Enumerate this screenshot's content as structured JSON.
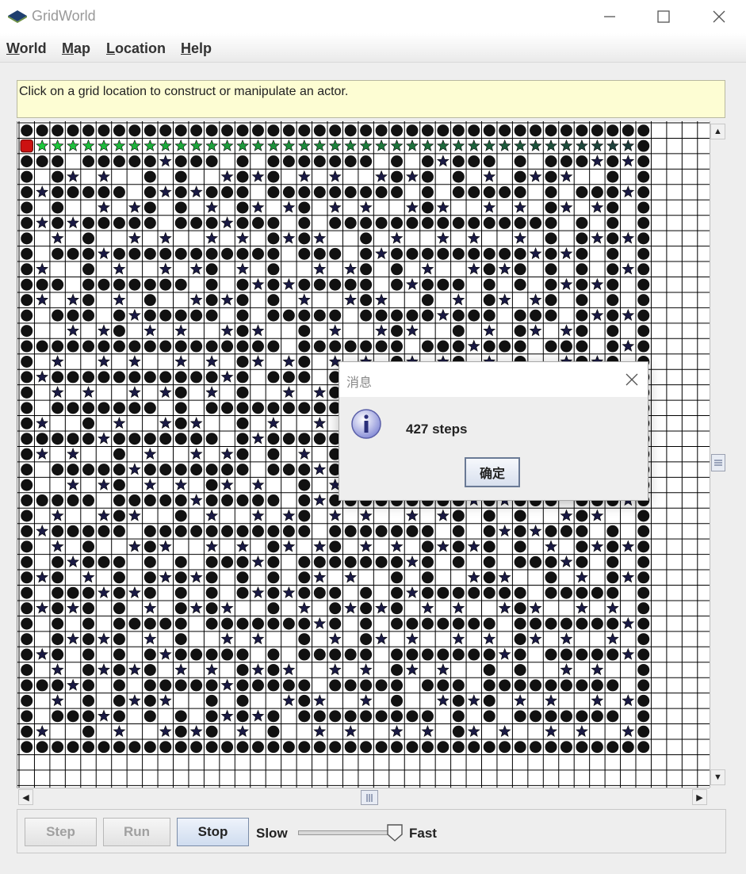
{
  "window": {
    "title": "GridWorld"
  },
  "menu": [
    {
      "label": "World",
      "mnemonic": "W",
      "rest": "orld"
    },
    {
      "label": "Map",
      "mnemonic": "M",
      "rest": "ap"
    },
    {
      "label": "Location",
      "mnemonic": "L",
      "rest": "ocation"
    },
    {
      "label": "Help",
      "mnemonic": "H",
      "rest": "elp"
    }
  ],
  "info": {
    "message": "Click on a grid location to construct or manipulate an actor."
  },
  "controls": {
    "step_label": "Step",
    "run_label": "Run",
    "stop_label": "Stop",
    "slow_label": "Slow",
    "fast_label": "Fast",
    "speed_value": 0.95
  },
  "dialog": {
    "title": "消息",
    "message": "427 steps",
    "ok_label": "确定"
  },
  "colors": {
    "rock": "#111111",
    "flower_blue": "#1a1a44",
    "flower_green": "#22cc33",
    "bug": "#cc1111",
    "grid_line": "#000000"
  },
  "icons": [
    "app-icon",
    "minimize-icon",
    "maximize-icon",
    "close-icon",
    "info-icon",
    "arrow-up-icon",
    "arrow-down-icon",
    "arrow-left-icon",
    "arrow-right-icon",
    "dialog-close-icon"
  ]
}
